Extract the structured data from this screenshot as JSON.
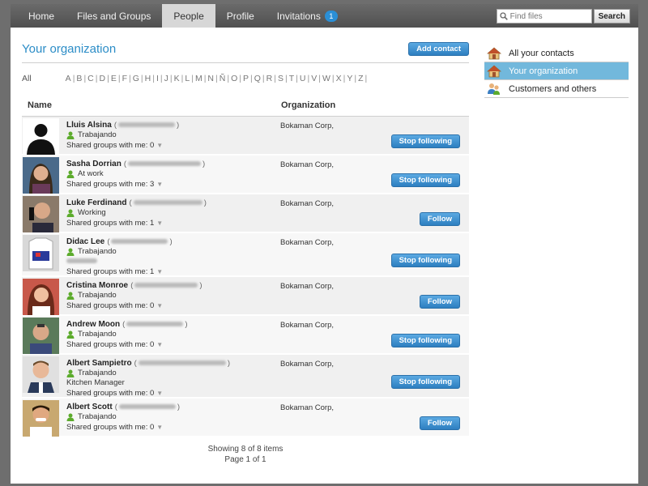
{
  "nav": {
    "tabs": [
      {
        "label": "Home"
      },
      {
        "label": "Files and Groups"
      },
      {
        "label": "People"
      },
      {
        "label": "Profile"
      },
      {
        "label": "Invitations",
        "badge": "1"
      }
    ],
    "active_tab": "People",
    "search_placeholder": "Find files",
    "search_button": "Search"
  },
  "main": {
    "title": "Your organization",
    "add_contact": "Add contact",
    "alpha_all": "All",
    "letters": [
      "A",
      "B",
      "C",
      "D",
      "E",
      "F",
      "G",
      "H",
      "I",
      "J",
      "K",
      "L",
      "M",
      "N",
      "Ñ",
      "O",
      "P",
      "Q",
      "R",
      "S",
      "T",
      "U",
      "V",
      "W",
      "X",
      "Y",
      "Z"
    ],
    "col_name": "Name",
    "col_org": "Organization"
  },
  "people": [
    {
      "name": "Lluis Alsina",
      "status": "Trabajando",
      "extra": "",
      "shared": "Shared groups with me: 0",
      "org": "Bokaman Corp,",
      "action": "Stop following",
      "height": 48
    },
    {
      "name": "Sasha Dorrian",
      "status": "At work",
      "extra": "",
      "shared": "Shared groups with me: 3",
      "org": "Bokaman Corp,",
      "action": "Stop following",
      "height": 48
    },
    {
      "name": "Luke Ferdinand",
      "status": "Working",
      "extra": "",
      "shared": "Shared groups with me: 1",
      "org": "Bokaman Corp,",
      "action": "Follow",
      "height": 48
    },
    {
      "name": "Didac Lee",
      "status": "Trabajando",
      "extra": "blur",
      "shared": "Shared groups with me: 1",
      "org": "Bokaman Corp,",
      "action": "Stop following",
      "height": 54
    },
    {
      "name": "Cristina Monroe",
      "status": "Trabajando",
      "extra": "",
      "shared": "Shared groups with me: 0",
      "org": "Bokaman Corp,",
      "action": "Follow",
      "height": 48
    },
    {
      "name": "Andrew Moon",
      "status": "Trabajando",
      "extra": "",
      "shared": "Shared groups with me: 0",
      "org": "Bokaman Corp,",
      "action": "Stop following",
      "height": 48
    },
    {
      "name": "Albert Sampietro",
      "status": "Trabajando",
      "extra": "Kitchen Manager",
      "shared": "Shared groups with me: 0",
      "org": "Bokaman Corp,",
      "action": "Stop following",
      "height": 54
    },
    {
      "name": "Albert Scott",
      "status": "Trabajando",
      "extra": "",
      "shared": "Shared groups with me: 0",
      "org": "Bokaman Corp,",
      "action": "Follow",
      "height": 48
    }
  ],
  "footer": {
    "showing": "Showing 8 of 8 items",
    "page": "Page 1 of 1"
  },
  "sidebar": {
    "items": [
      {
        "label": "All your contacts",
        "icon": "house-icon"
      },
      {
        "label": "Your organization",
        "icon": "house-icon",
        "active": true
      },
      {
        "label": "Customers and others",
        "icon": "people-icon"
      }
    ]
  },
  "colors": {
    "accent": "#2c8dc7",
    "button": "#2d7fc0",
    "sidebar_active": "#72b8dc",
    "status_green": "#5cab2c"
  }
}
